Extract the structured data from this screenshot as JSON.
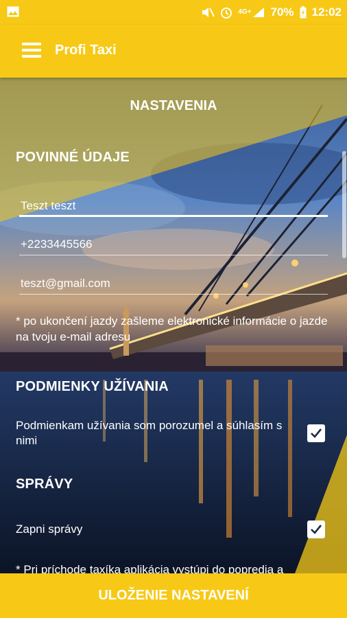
{
  "status_bar": {
    "battery_percent": "70%",
    "time": "12:02",
    "network_label": "4G+",
    "icons": [
      "image-icon",
      "mute-icon",
      "alarm-icon",
      "signal-icon",
      "battery-icon"
    ]
  },
  "toolbar": {
    "title": "Profi Taxi",
    "menu_icon": "hamburger-icon"
  },
  "page": {
    "title": "NASTAVENIA"
  },
  "required": {
    "title": "POVINNÉ ÚDAJE",
    "name_value": "Teszt teszt",
    "phone_value": "+2233445566",
    "email_value": "teszt@gmail.com",
    "note": "* po ukončení jazdy zašleme elektronické informácie o jazde na tvoju e-mail adresu"
  },
  "terms": {
    "title": "PODMIENKY UŽÍVANIA",
    "text": "Podmienkam užívania som porozumel a súhlasím s nimi",
    "checked": true
  },
  "messages": {
    "title": "SPRÁVY",
    "toggle_text": "Zapni správy",
    "checked": true,
    "note": "* Pri príchode taxíka aplikácia vystúpi do popredia a"
  },
  "save": {
    "label": "ULOŽENIE NASTAVENÍ"
  },
  "colors": {
    "accent": "#f7c916",
    "text": "#ffffff"
  }
}
